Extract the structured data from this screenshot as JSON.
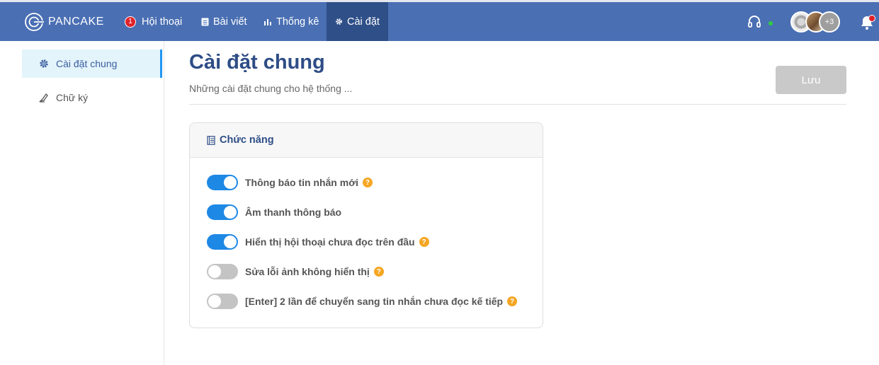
{
  "app": {
    "logo_text": "PANCAKE"
  },
  "nav": {
    "items": [
      {
        "label": "Hội thoại",
        "badge": "1"
      },
      {
        "label": "Bài viết"
      },
      {
        "label": "Thống kê"
      },
      {
        "label": "Cài đặt"
      }
    ],
    "avatar_more": "+3"
  },
  "sidebar": {
    "items": [
      {
        "label": "Cài đặt chung",
        "active": true
      },
      {
        "label": "Chữ ký",
        "active": false
      }
    ]
  },
  "main": {
    "title": "Cài đặt chung",
    "subtitle": "Những cài đặt chung cho hệ thống ...",
    "save_label": "Lưu",
    "card": {
      "title": "Chức năng",
      "options": [
        {
          "label": "Thông báo tin nhắn mới",
          "enabled": true,
          "help": "?"
        },
        {
          "label": "Âm thanh thông báo",
          "enabled": true
        },
        {
          "label": "Hiển thị hội thoại chưa đọc trên đầu",
          "enabled": true,
          "help": "?"
        },
        {
          "label": "Sửa lỗi ảnh không hiển thị",
          "enabled": false,
          "help": "?"
        },
        {
          "label": "[Enter] 2 lần để chuyển sang tin nhắn chưa đọc kế tiếp",
          "enabled": false,
          "help": "?"
        }
      ]
    }
  },
  "colors": {
    "topbar": "#4a6fb3",
    "nav_active": "#2f4f88",
    "toggle_on": "#1e88e5",
    "toggle_off": "#c4c4c4",
    "help_icon": "#f5a623",
    "save_disabled": "#c9c9c9"
  }
}
